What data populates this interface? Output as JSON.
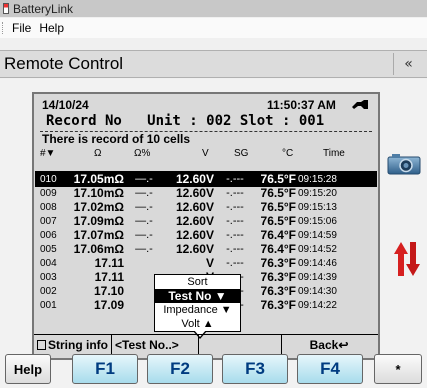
{
  "app": {
    "title": "BatteryLink"
  },
  "menu": {
    "file": "File",
    "help": "Help"
  },
  "panel": {
    "title": "Remote Control",
    "collapse_glyph": "«"
  },
  "lcd": {
    "date": "14/10/24",
    "time": "11:50:37 AM",
    "record_line": "Record No   Unit : 002 Slot : 001",
    "info_line": "There is record of 10 cells",
    "headers": {
      "no": "#▼",
      "ohm": "Ω",
      "pct": "Ω%",
      "volt": "V",
      "sg": "SG",
      "temp": "°C",
      "time": "Time"
    },
    "rows": [
      {
        "no": "010",
        "v": "17.05mΩ",
        "pct": "—.-",
        "volt": "12.60V",
        "sg": "-.---",
        "temp": "76.5°F",
        "time": "09:15:28",
        "selected": true
      },
      {
        "no": "009",
        "v": "17.10mΩ",
        "pct": "—.-",
        "volt": "12.60V",
        "sg": "-.---",
        "temp": "76.5°F",
        "time": "09:15:20"
      },
      {
        "no": "008",
        "v": "17.02mΩ",
        "pct": "—.-",
        "volt": "12.60V",
        "sg": "-.---",
        "temp": "76.5°F",
        "time": "09:15:13"
      },
      {
        "no": "007",
        "v": "17.09mΩ",
        "pct": "—.-",
        "volt": "12.60V",
        "sg": "-.---",
        "temp": "76.5°F",
        "time": "09:15:06"
      },
      {
        "no": "006",
        "v": "17.07mΩ",
        "pct": "—.-",
        "volt": "12.60V",
        "sg": "-.---",
        "temp": "76.4°F",
        "time": "09:14:59"
      },
      {
        "no": "005",
        "v": "17.06mΩ",
        "pct": "—.-",
        "volt": "12.60V",
        "sg": "-.---",
        "temp": "76.4°F",
        "time": "09:14:52"
      },
      {
        "no": "004",
        "v": "17.11",
        "pct": "",
        "volt": "V",
        "sg": "-.---",
        "temp": "76.3°F",
        "time": "09:14:46"
      },
      {
        "no": "003",
        "v": "17.11",
        "pct": "",
        "volt": "V",
        "sg": "-.---",
        "temp": "76.3°F",
        "time": "09:14:39"
      },
      {
        "no": "002",
        "v": "17.10",
        "pct": "",
        "volt": "V",
        "sg": "-.---",
        "temp": "76.3°F",
        "time": "09:14:30"
      },
      {
        "no": "001",
        "v": "17.09",
        "pct": "",
        "volt": "V",
        "sg": "-.---",
        "temp": "76.3°F",
        "time": "09:14:22"
      }
    ],
    "sort_popup": {
      "title": "Sort",
      "options": [
        "Test No ▼",
        "Impedance ▼",
        "Volt ▲"
      ],
      "active_index": 0
    },
    "bottom": {
      "string_info": "String info",
      "test_no": "<Test No..>",
      "back": "Back↩"
    }
  },
  "buttons": {
    "help": "Help",
    "f1": "F1",
    "f2": "F2",
    "f3": "F3",
    "f4": "F4",
    "star": "*"
  },
  "colors": {
    "accent": "#a8dcec",
    "fn_text": "#003b80",
    "alert_red": "#d62020"
  },
  "icons": {
    "camera": "camera-icon",
    "updown": "up-down-arrows-icon",
    "plug": "plug-icon"
  }
}
